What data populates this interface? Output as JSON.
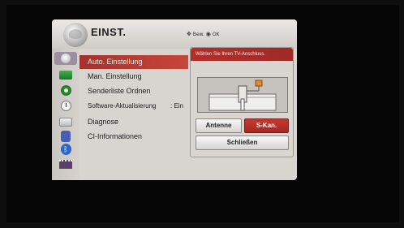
{
  "header": {
    "title": "EINST.",
    "nav_hint": "Bew.",
    "ok_hint": "OK"
  },
  "menu": {
    "items": [
      {
        "label": "Auto. Einstellung",
        "selected": true
      },
      {
        "label": "Man. Einstellung"
      },
      {
        "label": "Senderliste Ordnen"
      },
      {
        "label": "Software-Aktualisierung",
        "value": ": Ein"
      },
      {
        "label": "Diagnose"
      },
      {
        "label": "CI-Informationen"
      }
    ]
  },
  "side_icons": [
    "satellite-icon",
    "picture-icon",
    "audio-icon",
    "clock-icon",
    "option-icon",
    "lock-icon",
    "bluetooth-icon",
    "media-icon"
  ],
  "dialog": {
    "title": "Wählen Sie Ihren TV-Anschluss.",
    "buttons": {
      "antenna": "Antenne",
      "satellite": "S-Kan.",
      "close": "Schließen"
    }
  },
  "colors": {
    "accent": "#b22f2a",
    "panel": "#d8d5d0",
    "background": "#050505"
  }
}
